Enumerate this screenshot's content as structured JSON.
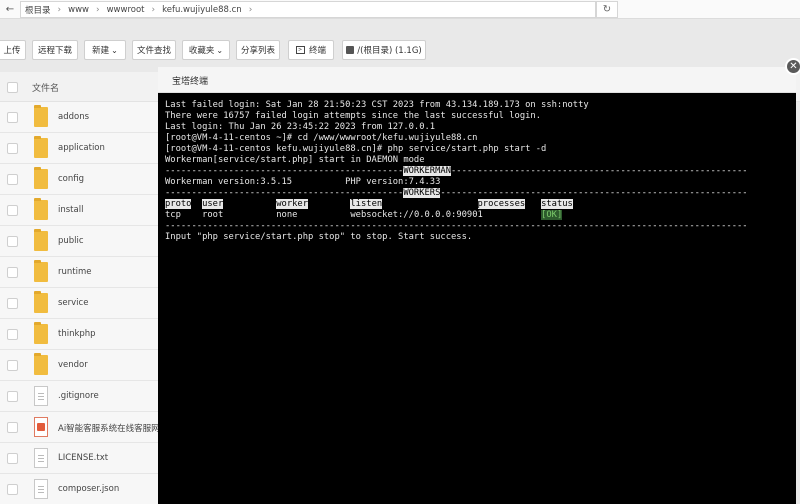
{
  "address_bar": {
    "crumbs": [
      "根目录",
      "www",
      "wwwroot",
      "kefu.wujiyule88.cn"
    ]
  },
  "toolbar": {
    "upload": "上传",
    "remote_download": "远程下载",
    "new": "新建",
    "file_search": "文件查找",
    "favorites": "收藏夹",
    "share_list": "分享列表",
    "terminal": "终端",
    "disk": "/(根目录) (1.1G)"
  },
  "file_list": {
    "header_name": "文件名",
    "rows": [
      {
        "name": "addons",
        "type": "folder"
      },
      {
        "name": "application",
        "type": "folder"
      },
      {
        "name": "config",
        "type": "folder"
      },
      {
        "name": "install",
        "type": "folder"
      },
      {
        "name": "public",
        "type": "folder"
      },
      {
        "name": "runtime",
        "type": "folder"
      },
      {
        "name": "service",
        "type": "folder"
      },
      {
        "name": "thinkphp",
        "type": "folder"
      },
      {
        "name": "vendor",
        "type": "folder"
      },
      {
        "name": ".gitignore",
        "type": "file"
      },
      {
        "name": "Ai智能客服系统在线客服网页",
        "type": "app"
      },
      {
        "name": "LICENSE.txt",
        "type": "file"
      },
      {
        "name": "composer.json",
        "type": "file"
      }
    ]
  },
  "dialog": {
    "title": "宝塔终端",
    "lines": [
      "Last failed login: Sat Jan 28 21:50:23 CST 2023 from 43.134.189.173 on ssh:notty",
      "There were 16757 failed login attempts since the last successful login.",
      "Last login: Thu Jan 26 23:45:22 2023 from 127.0.0.1",
      "[root@VM-4-11-centos ~]# cd /www/wwwroot/kefu.wujiyule88.cn",
      "[root@VM-4-11-centos kefu.wujiyule88.cn]# php service/start.php start -d",
      "Workerman[service/start.php] start in DAEMON mode"
    ],
    "rule_char": "-",
    "workerman_label": "WORKERMAN",
    "version_line": "Workerman version:3.5.15          PHP version:7.4.33",
    "workers_label": "WORKERS",
    "table_headers": [
      "proto",
      "user",
      "worker",
      "listen",
      "processes",
      "status"
    ],
    "table_row": [
      "tcp",
      "root",
      "none",
      "websocket://0.0.0.0:9090",
      "1",
      "[OK]"
    ],
    "final_line": "Input \"php service/start.php stop\" to stop. Start success."
  },
  "colors": {
    "terminal_bg": "#000000",
    "terminal_text": "#e8e8e8",
    "ok_green": "#7bc96b",
    "folder": "#f1bc3f"
  },
  "icons": {
    "back": "arrow-left-icon",
    "refresh": "refresh-icon",
    "terminal": "terminal-icon",
    "disk": "disk-icon",
    "close": "close-icon"
  }
}
